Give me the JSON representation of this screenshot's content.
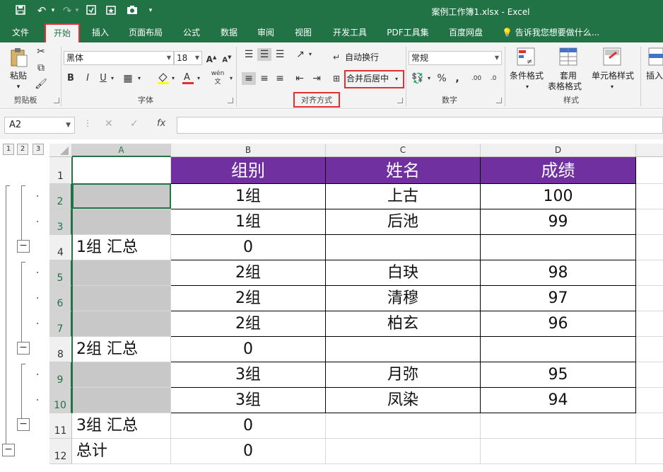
{
  "titlebar": {
    "title": "案例工作簿1.xlsx - Excel",
    "save_icon": "save-icon",
    "undo_icon": "undo-icon",
    "redo_icon": "redo-icon"
  },
  "tabs": {
    "file": "文件",
    "home": "开始",
    "insert": "插入",
    "page_layout": "页面布局",
    "formulas": "公式",
    "data": "数据",
    "review": "审阅",
    "view": "视图",
    "developer": "开发工具",
    "pdf": "PDF工具集",
    "baidu": "百度网盘",
    "tell_me": "告诉我您想要做什么..."
  },
  "ribbon": {
    "clipboard": {
      "paste": "粘贴",
      "label": "剪贴板"
    },
    "font": {
      "name": "黑体",
      "size": "18",
      "label": "字体",
      "phonetic": "wén"
    },
    "alignment": {
      "wrap": "自动换行",
      "merge": "合并后居中",
      "label": "对齐方式"
    },
    "number": {
      "format": "常规",
      "label": "数字"
    },
    "styles": {
      "conditional": "条件格式",
      "table_1": "套用",
      "table_2": "表格格式",
      "cell_styles": "单元格样式",
      "label": "样式"
    },
    "insert": "插入"
  },
  "formula_bar": {
    "name_box": "A2",
    "fx": "fx",
    "value": ""
  },
  "outline_levels": [
    "1",
    "2",
    "3"
  ],
  "columns": [
    "A",
    "B",
    "C",
    "D"
  ],
  "rows": [
    {
      "num": "1",
      "a": "",
      "b": "组别",
      "c": "姓名",
      "d": "成绩"
    },
    {
      "num": "2",
      "a": "",
      "b": "1组",
      "c": "上古",
      "d": "100"
    },
    {
      "num": "3",
      "a": "",
      "b": "1组",
      "c": "后池",
      "d": "99"
    },
    {
      "num": "4",
      "a": "1组 汇总",
      "b": "0",
      "c": "",
      "d": ""
    },
    {
      "num": "5",
      "a": "",
      "b": "2组",
      "c": "白玦",
      "d": "98"
    },
    {
      "num": "6",
      "a": "",
      "b": "2组",
      "c": "清穆",
      "d": "97"
    },
    {
      "num": "7",
      "a": "",
      "b": "2组",
      "c": "柏玄",
      "d": "96"
    },
    {
      "num": "8",
      "a": "2组 汇总",
      "b": "0",
      "c": "",
      "d": ""
    },
    {
      "num": "9",
      "a": "",
      "b": "3组",
      "c": "月弥",
      "d": "95"
    },
    {
      "num": "10",
      "a": "",
      "b": "3组",
      "c": "凤染",
      "d": "94"
    },
    {
      "num": "11",
      "a": "3组 汇总",
      "b": "0",
      "c": "",
      "d": ""
    },
    {
      "num": "12",
      "a": "总计",
      "b": "0",
      "c": "",
      "d": ""
    }
  ],
  "colors": {
    "excel_green": "#217346",
    "header_purple": "#7030a0",
    "highlight_red": "#e03030",
    "merged_grey": "#c8c8c8"
  }
}
